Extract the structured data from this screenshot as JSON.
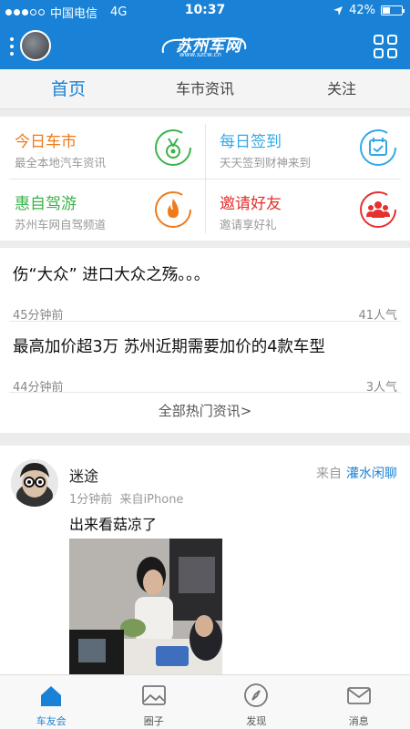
{
  "status_bar": {
    "carrier": "中国电信",
    "network": "4G",
    "time": "10:37",
    "battery": "42%",
    "battery_level": 0.42
  },
  "header": {
    "logo_text": "苏州车网",
    "logo_url": "www.szcw.cn"
  },
  "tabs": [
    {
      "label": "首页",
      "active": true
    },
    {
      "label": "车市资讯"
    },
    {
      "label": "关注"
    }
  ],
  "quick_links": [
    {
      "title": "今日车市",
      "subtitle": "最全本地汽车资讯",
      "color": "#ef7a1a",
      "icon": "medal-icon"
    },
    {
      "title": "每日签到",
      "subtitle": "天天签到财神来到",
      "color": "#31a9e6",
      "icon": "calendar-check-icon"
    },
    {
      "title": "惠自驾游",
      "subtitle": "苏州车网自驾频道",
      "color": "#3ab34a",
      "icon": "flame-icon"
    },
    {
      "title": "邀请好友",
      "subtitle": "邀请享好礼",
      "color": "#e5302e",
      "icon": "people-icon"
    }
  ],
  "news": [
    {
      "title": "伤“大众” 进口大众之殇。。。",
      "time": "45分钟前",
      "views": "41人气"
    },
    {
      "title": "最高加价超3万 苏州近期需要加价的4款车型",
      "time": "44分钟前",
      "views": "3人气"
    }
  ],
  "news_more": "全部热门资讯>",
  "post": {
    "author": "迷途",
    "from_label": "来自",
    "forum": "灌水闲聊",
    "time": "1分钟前",
    "device": "来自iPhone",
    "text": "出来看菇凉了"
  },
  "bottom_nav": [
    {
      "label": "车友会",
      "icon": "home-icon",
      "active": true
    },
    {
      "label": "圈子",
      "icon": "image-icon"
    },
    {
      "label": "发现",
      "icon": "compass-icon"
    },
    {
      "label": "消息",
      "icon": "envelope-icon"
    }
  ],
  "colors": {
    "brand": "#1a82d6"
  }
}
